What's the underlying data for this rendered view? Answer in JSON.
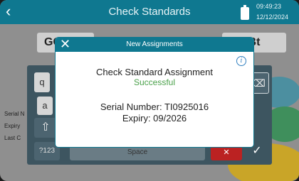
{
  "header": {
    "back_glyph": "‹",
    "title": "Check Standards",
    "time": "09:49:23",
    "date": "12/12/2024"
  },
  "background": {
    "button_left": "GC",
    "button_right": "Bt",
    "labels": [
      "Serial N",
      "Expiry",
      "Last C"
    ],
    "keys": {
      "q": "q",
      "a": "a",
      "num": "?123",
      "space": "Space",
      "delete": "⌫",
      "shift": "⇧",
      "cancel": "✕",
      "ok": "✓"
    }
  },
  "modal": {
    "title": "New Assignments",
    "close_glyph": "✕",
    "info_glyph": "i",
    "message_line1": "Check Standard Assignment",
    "message_line2": "Successful",
    "serial_line": "Serial Number: TI0925016",
    "expiry_line": "Expiry: 09/2026"
  },
  "colors": {
    "header": "#0f7890",
    "success": "#4aa14a"
  }
}
